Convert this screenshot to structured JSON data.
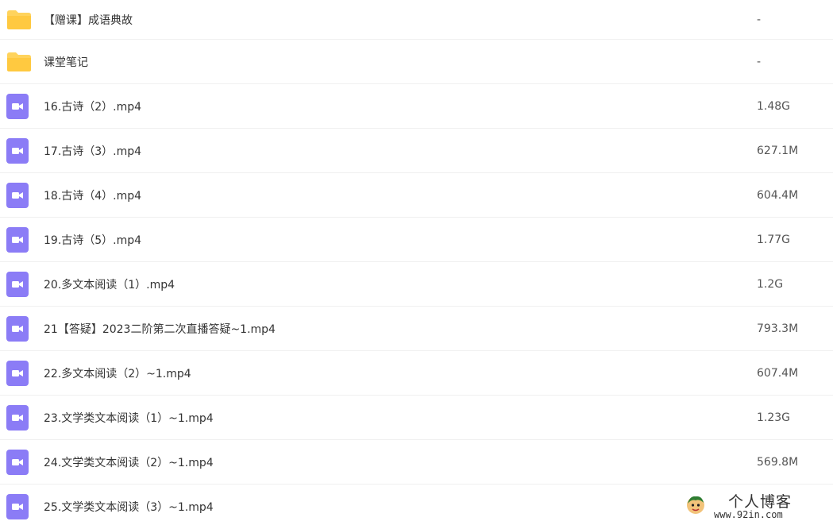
{
  "files": [
    {
      "type": "folder",
      "name": "【赠课】成语典故",
      "size": "-"
    },
    {
      "type": "folder",
      "name": "课堂笔记",
      "size": "-"
    },
    {
      "type": "video",
      "name": "16.古诗（2）.mp4",
      "size": "1.48G"
    },
    {
      "type": "video",
      "name": "17.古诗（3）.mp4",
      "size": "627.1M"
    },
    {
      "type": "video",
      "name": "18.古诗（4）.mp4",
      "size": "604.4M"
    },
    {
      "type": "video",
      "name": "19.古诗（5）.mp4",
      "size": "1.77G"
    },
    {
      "type": "video",
      "name": "20.多文本阅读（1）.mp4",
      "size": "1.2G"
    },
    {
      "type": "video",
      "name": "21【答疑】2023二阶第二次直播答疑~1.mp4",
      "size": "793.3M"
    },
    {
      "type": "video",
      "name": "22.多文本阅读（2）~1.mp4",
      "size": "607.4M"
    },
    {
      "type": "video",
      "name": "23.文学类文本阅读（1）~1.mp4",
      "size": "1.23G"
    },
    {
      "type": "video",
      "name": "24.文学类文本阅读（2）~1.mp4",
      "size": "569.8M"
    },
    {
      "type": "video",
      "name": "25.文学类文本阅读（3）~1.mp4",
      "size": ""
    }
  ],
  "icons": {
    "folder": "folder-icon",
    "video": "video-file-icon"
  },
  "colors": {
    "folder": "#FFD35C",
    "video": "#8B7CF6"
  },
  "watermark": {
    "title": "个人博客",
    "url": "www.92in.com"
  }
}
